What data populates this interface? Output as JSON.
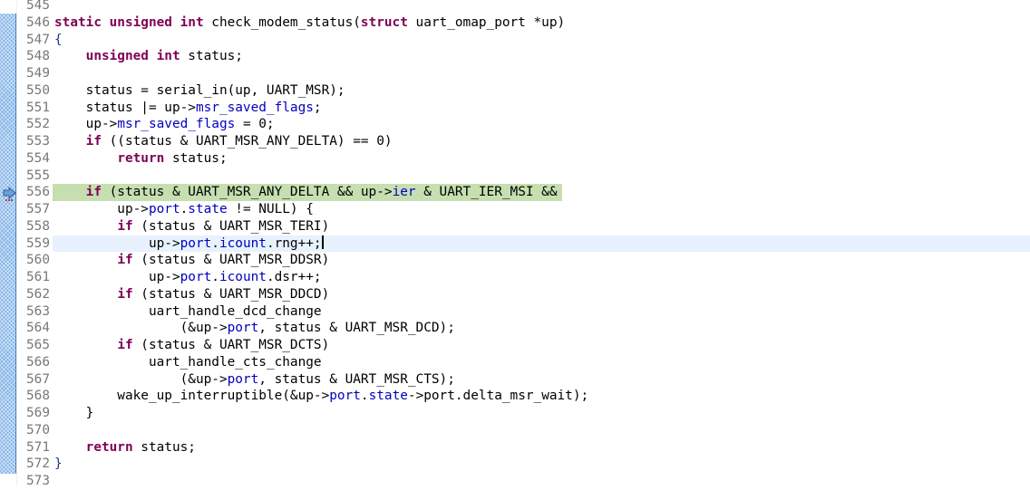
{
  "editor": {
    "cursor_line": 559,
    "debug_line": 556,
    "colors": {
      "keyword": "#7f0055",
      "field": "#0000c0",
      "debug_highlight": "#c6dfb1",
      "current_line": "#e8f2fe"
    },
    "lines": [
      {
        "n": "545",
        "seg": []
      },
      {
        "n": "546",
        "seg": [
          [
            "static unsigned int",
            "k"
          ],
          [
            " check_modem_status(",
            ""
          ],
          [
            "struct",
            "k"
          ],
          [
            " uart_omap_port *up)",
            ""
          ]
        ]
      },
      {
        "n": "547",
        "seg": [
          [
            "{",
            "b"
          ]
        ]
      },
      {
        "n": "548",
        "seg": [
          [
            "    ",
            ""
          ],
          [
            "unsigned int",
            "k"
          ],
          [
            " status;",
            ""
          ]
        ]
      },
      {
        "n": "549",
        "seg": []
      },
      {
        "n": "550",
        "seg": [
          [
            "    status = serial_in(up, UART_MSR);",
            ""
          ]
        ]
      },
      {
        "n": "551",
        "seg": [
          [
            "    status |= up->",
            ""
          ],
          [
            "msr_saved_flags",
            "f"
          ],
          [
            ";",
            ""
          ]
        ]
      },
      {
        "n": "552",
        "seg": [
          [
            "    up->",
            ""
          ],
          [
            "msr_saved_flags",
            "f"
          ],
          [
            " = 0;",
            ""
          ]
        ]
      },
      {
        "n": "553",
        "seg": [
          [
            "    ",
            ""
          ],
          [
            "if",
            "k"
          ],
          [
            " ((status & UART_MSR_ANY_DELTA) == 0)",
            ""
          ]
        ]
      },
      {
        "n": "554",
        "seg": [
          [
            "        ",
            ""
          ],
          [
            "return",
            "k"
          ],
          [
            " status;",
            ""
          ]
        ]
      },
      {
        "n": "555",
        "seg": []
      },
      {
        "n": "556",
        "seg": [
          [
            "    ",
            ""
          ],
          [
            "if",
            "k"
          ],
          [
            " (status & UART_MSR_ANY_DELTA && up->",
            ""
          ],
          [
            "ier",
            "f"
          ],
          [
            " & UART_IER_MSI &&",
            ""
          ]
        ]
      },
      {
        "n": "557",
        "seg": [
          [
            "        up->",
            ""
          ],
          [
            "port",
            "f"
          ],
          [
            ".",
            ""
          ],
          [
            "state",
            "f"
          ],
          [
            " != NULL) {",
            ""
          ]
        ]
      },
      {
        "n": "558",
        "seg": [
          [
            "        ",
            ""
          ],
          [
            "if",
            "k"
          ],
          [
            " (status & UART_MSR_TERI)",
            ""
          ]
        ]
      },
      {
        "n": "559",
        "seg": [
          [
            "            up->",
            ""
          ],
          [
            "port",
            "f"
          ],
          [
            ".",
            ""
          ],
          [
            "icount",
            "f"
          ],
          [
            ".rng++;",
            ""
          ]
        ]
      },
      {
        "n": "560",
        "seg": [
          [
            "        ",
            ""
          ],
          [
            "if",
            "k"
          ],
          [
            " (status & UART_MSR_DDSR)",
            ""
          ]
        ]
      },
      {
        "n": "561",
        "seg": [
          [
            "            up->",
            ""
          ],
          [
            "port",
            "f"
          ],
          [
            ".",
            ""
          ],
          [
            "icount",
            "f"
          ],
          [
            ".dsr++;",
            ""
          ]
        ]
      },
      {
        "n": "562",
        "seg": [
          [
            "        ",
            ""
          ],
          [
            "if",
            "k"
          ],
          [
            " (status & UART_MSR_DDCD)",
            ""
          ]
        ]
      },
      {
        "n": "563",
        "seg": [
          [
            "            uart_handle_dcd_change",
            ""
          ]
        ]
      },
      {
        "n": "564",
        "seg": [
          [
            "                (&up->",
            ""
          ],
          [
            "port",
            "f"
          ],
          [
            ", status & UART_MSR_DCD);",
            ""
          ]
        ]
      },
      {
        "n": "565",
        "seg": [
          [
            "        ",
            ""
          ],
          [
            "if",
            "k"
          ],
          [
            " (status & UART_MSR_DCTS)",
            ""
          ]
        ]
      },
      {
        "n": "566",
        "seg": [
          [
            "            uart_handle_cts_change",
            ""
          ]
        ]
      },
      {
        "n": "567",
        "seg": [
          [
            "                (&up->",
            ""
          ],
          [
            "port",
            "f"
          ],
          [
            ", status & UART_MSR_CTS);",
            ""
          ]
        ]
      },
      {
        "n": "568",
        "seg": [
          [
            "        wake_up_interruptible(&up->",
            ""
          ],
          [
            "port",
            "f"
          ],
          [
            ".",
            ""
          ],
          [
            "state",
            "f"
          ],
          [
            "->port.delta_msr_wait);",
            ""
          ]
        ]
      },
      {
        "n": "569",
        "seg": [
          [
            "    }",
            ""
          ]
        ]
      },
      {
        "n": "570",
        "seg": []
      },
      {
        "n": "571",
        "seg": [
          [
            "    ",
            ""
          ],
          [
            "return",
            "k"
          ],
          [
            " status;",
            ""
          ]
        ]
      },
      {
        "n": "572",
        "seg": [
          [
            "}",
            "b"
          ]
        ]
      },
      {
        "n": "573",
        "seg": []
      }
    ]
  }
}
